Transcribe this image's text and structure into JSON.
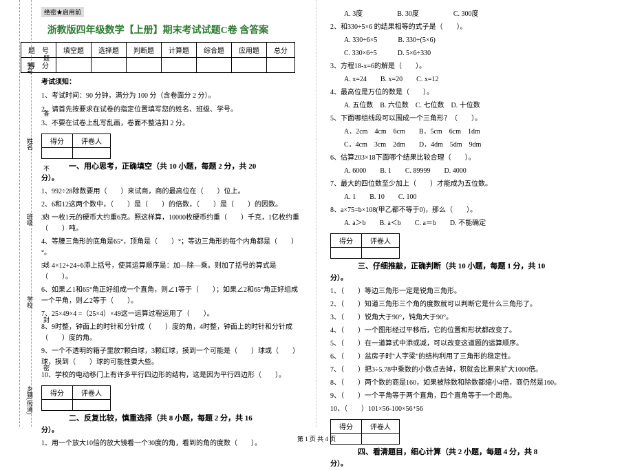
{
  "binding": {
    "l1": "乡镇(街道)",
    "l2": "学校",
    "l3": "班级",
    "l4": "姓名",
    "l5": "学号",
    "m1": "密",
    "m2": "封",
    "m3": "线",
    "m4": "内",
    "m5": "不",
    "m6": "答",
    "m7": "题"
  },
  "secret": "绝密★启用前",
  "title": "浙教版四年级数学【上册】期末考试试题C卷 含答案",
  "score_table": {
    "h0": "题　号",
    "h1": "填空题",
    "h2": "选择题",
    "h3": "判断题",
    "h4": "计算题",
    "h5": "综合题",
    "h6": "应用题",
    "h7": "总分",
    "r0": "得　分"
  },
  "notice": {
    "head": "考试须知：",
    "n1": "1、考试时间：90 分钟，满分为 100 分（含卷面分 2 分）。",
    "n2": "2、请首先按要求在试卷的指定位置填写您的姓名、班级、学号。",
    "n3": "3、不要在试卷上乱写乱画，卷面不整洁扣 2 分。"
  },
  "mini": {
    "c1": "得分",
    "c2": "评卷人"
  },
  "s1": {
    "title": "一、用心思考，正确填空（共 10 小题，每题 2 分，共 20",
    "suffix": "分）。"
  },
  "s1q": {
    "q1": "1、992÷28除数要用（　　）来试商，商的最高位在（　　）位上。",
    "q2": "2、6和12这两个数中，（　　）是（　　）的倍数，（　　）是（　　）的因数。",
    "q3": "3、一枚1元的硬币大约重6克。照这样算，10000枚硬币约重（　　）千克，1亿枚约重（　　）吨。",
    "q4": "4、等腰三角形的底角是65°，顶角是（　　）°；等边三角形的每个内角都是（　　）°。",
    "q5": "5、4×12+24÷6添上括号，使其运算顺序是：加—除—乘。则加了括号的算式是（　　）。",
    "q6": "6、如果∠1和65°角正好组成一个直角，则∠1等于（　　）；如果∠2和65°角正好组成一个平角，则∠2等于（　　）。",
    "q7": "7、25×49×4 =（25×4）×49这一运算过程运用了（　　）。",
    "q8": "8、9时整，钟面上的时针和分针成（　　）度的角，4时整，钟面上的时针和分针成（　　）度的角。",
    "q9": "9、一个不透明的箱子里放7颗白球，3颗红球，摸到一个可能是（　　）球或（　　）球，摸到（　　）球的可能性要大些。",
    "q10": "10、学校的电动移门上有许多平行四边形的结构，这是因为平行四边形（　　）。"
  },
  "s2": {
    "title": "二、反复比较，慎重选择（共 8 小题，每题 2 分，共 16",
    "suffix": "分）。"
  },
  "s2q": {
    "q1": "1、用一个放大10倍的放大镜看一个30度的角，看到的角的度数（　　）。",
    "q1o": "A. 3度　　　　　B. 30度　　　　　C. 300度",
    "q2": "2、和330÷5×6 的结果相等的式子是（　　）。",
    "q2oa": "A. 330÷6×5　　　B. 330÷(5×6)",
    "q2ob": "C. 330×6÷5　　　D. 5×6÷330",
    "q3": "3、方程18-x=6的解是（　　）。",
    "q3o": "A. x=24　　B. x=20　　C. x=12",
    "q4": "4、最高位是万位的数是（　　）。",
    "q4o": "A. 五位数　B. 六位数　C. 七位数　D. 十位数",
    "q5": "5、下面哪组线段可以围成一个三角形？（　　）。",
    "q5oa": "A．2cm　4cm　6cm　　B．5cm　6cm　1dm",
    "q5ob": "C．4cm　3cm　2dm　　D．4dm　5dm　9dm",
    "q6": "6、估算203×18下面哪个结果比较合理（　　）。",
    "q6o": "A. 6000　　B. 1　　C. 89999　　D. 4000",
    "q7": "7、最大的四位数至少加上（　　）才能成为五位数。",
    "q7o": "A. 1　　B. 10　　C. 100",
    "q8": "8、a×75=b×108(甲乙都不等于0)，那么（　　）。",
    "q8o": "A. a＞b　　B. a＜b　　C. a＝b　　D. 不能确定"
  },
  "s3": {
    "title": "三、仔细推敲，正确判断（共 10 小题，每题 1 分，共 10",
    "suffix": "分）。"
  },
  "s3q": {
    "q1": "1、（　　）等边三角形一定是锐角三角形。",
    "q2": "2、（　　）知道三角形三个角的度数就可以判断它是什么三角形了。",
    "q3": "3、（　　）锐角大于90°，钝角大于90°。",
    "q4": "4、（　　）一个图形经过平移后，它的位置和形状都改变了。",
    "q5": "5、（　　）在一道算式中添或减，可以改变这道题的运算顺序。",
    "q6": "6、（　　）盆房子时\"人字梁\"的结构利用了三角形的稳定性。",
    "q7": "7、（　　）把3÷5.78中乘数的小数点去掉，积就会比原来扩大1000倍。",
    "q8": "8、（　　）两个数的商是160，如果被除数和除数都缩小4倍，商仍然是160。",
    "q9": "9、（　　）一个平角等于两个直角，四个直角等于一个周角。",
    "q10": "10、（　　）101×56-100×56⁺56"
  },
  "s4": {
    "title": "四、看清题目，细心计算（共 2 小题，每题 4 分，共 8",
    "suffix": "分）。"
  },
  "footer": "第 1 页 共 4 页"
}
